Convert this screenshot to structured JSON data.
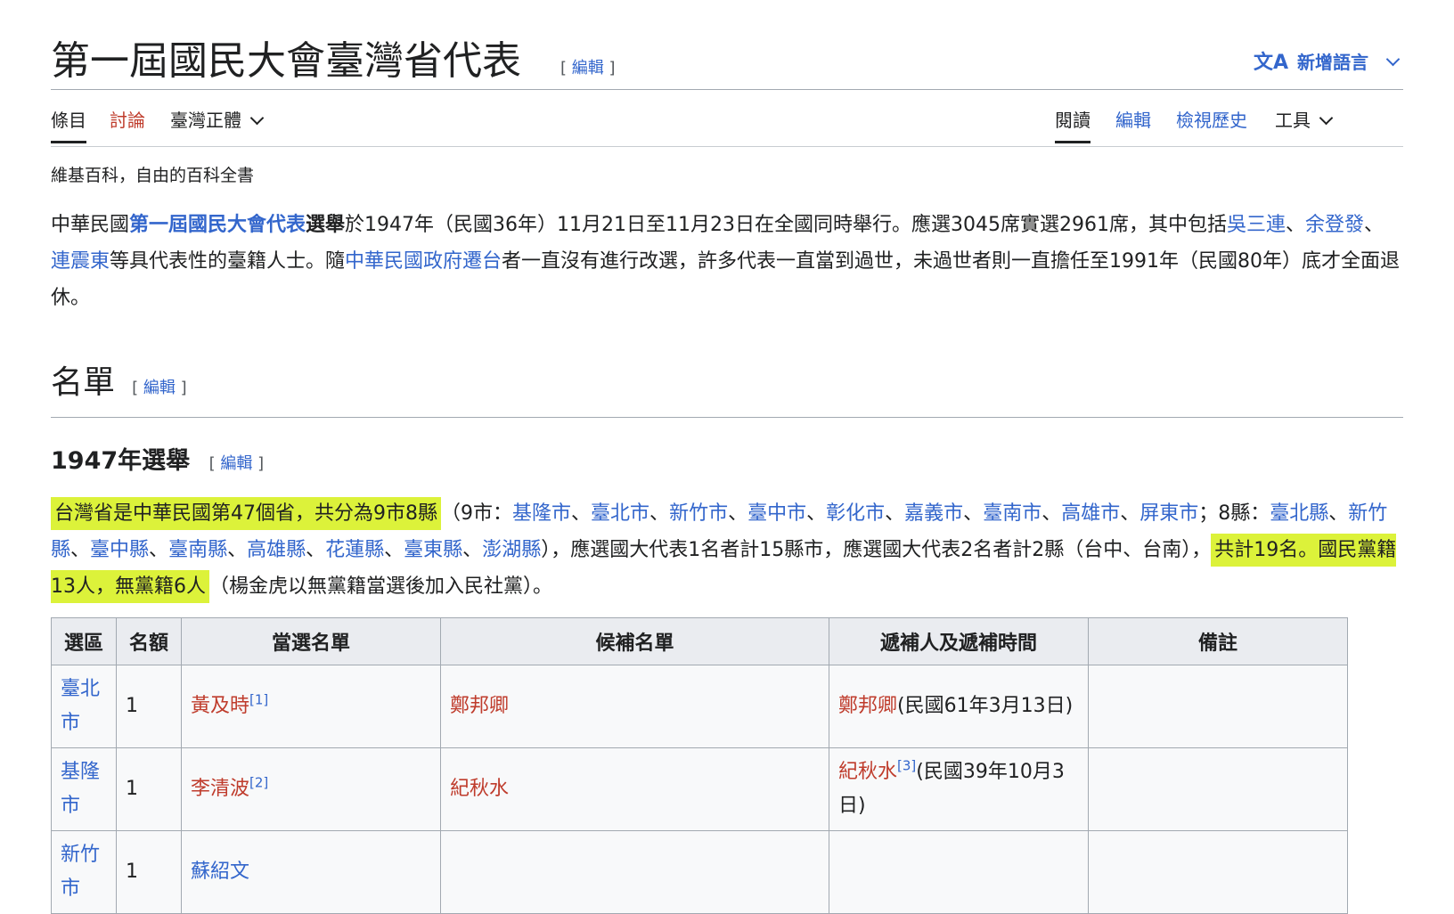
{
  "page": {
    "title": "第一屆國民大會臺灣省代表",
    "edit_label": "編輯",
    "bracket_open": "[",
    "bracket_close": "]",
    "lang_icon": "文A",
    "lang_label": "新增語言"
  },
  "tabs": {
    "left": [
      "條目",
      "討論",
      "臺灣正體"
    ],
    "right": [
      "閱讀",
      "編輯",
      "檢視歷史",
      "工具"
    ]
  },
  "tagline": "維基百科，自由的百科全書",
  "intro": {
    "t1": "中華民國",
    "l1": "第一屆國民大會代表",
    "t2": "選舉",
    "t3": "於1947年（民國36年）11月21日至11月23日在全國同時舉行。應選3045席實選2961席，其中包括",
    "l2": "吳三連",
    "t4": "、",
    "l3": "余登發",
    "t5": "、",
    "l4": "連震東",
    "t6": "等具代表性的臺籍人士。隨",
    "l5": "中華民國政府遷台",
    "t7": "者一直沒有進行改選，許多代表一直當到過世，未過世者則一直擔任至1991年（民國80年）底才全面退休。"
  },
  "section": {
    "h2": "名單",
    "h3": "1947年選舉"
  },
  "summary": {
    "hl1": "台灣省是中華民國第47個省，共分為9市8縣",
    "p1": "（9市：",
    "cities": [
      "基隆市",
      "臺北市",
      "新竹市",
      "臺中市",
      "彰化市",
      "嘉義市",
      "臺南市",
      "高雄市",
      "屏東市"
    ],
    "sep": "、",
    "p2": "；8縣：",
    "counties": [
      "臺北縣",
      "新竹縣",
      "臺中縣",
      "臺南縣",
      "高雄縣",
      "花蓮縣",
      "臺東縣",
      "澎湖縣"
    ],
    "p3": "），應選國大代表1名者計15縣市，應選國大代表2名者計2縣（台中、台南），",
    "hl2": "共計19名。國民黨籍13人，無黨籍6人",
    "p4": "（楊金虎以無黨籍當選後加入民社黨）。"
  },
  "table": {
    "headers": [
      "選區",
      "名額",
      "當選名單",
      "候補名單",
      "遞補人及遞補時間",
      "備註"
    ],
    "rows": [
      {
        "district": "臺北市",
        "seats": "1",
        "elected": "黃及時",
        "elected_ref": "[1]",
        "alternate": "鄭邦卿",
        "replacement": "鄭邦卿",
        "replacement_ref": "",
        "replacement_time": "(民國61年3月13日)",
        "note": ""
      },
      {
        "district": "基隆市",
        "seats": "1",
        "elected": "李清波",
        "elected_ref": "[2]",
        "alternate": "紀秋水",
        "replacement": "紀秋水",
        "replacement_ref": "[3]",
        "replacement_time": "(民國39年10月3日)",
        "note": ""
      },
      {
        "district": "新竹市",
        "seats": "1",
        "elected": "蘇紹文",
        "elected_ref": "",
        "alternate": "",
        "replacement": "",
        "replacement_ref": "",
        "replacement_time": "",
        "note": ""
      }
    ]
  }
}
